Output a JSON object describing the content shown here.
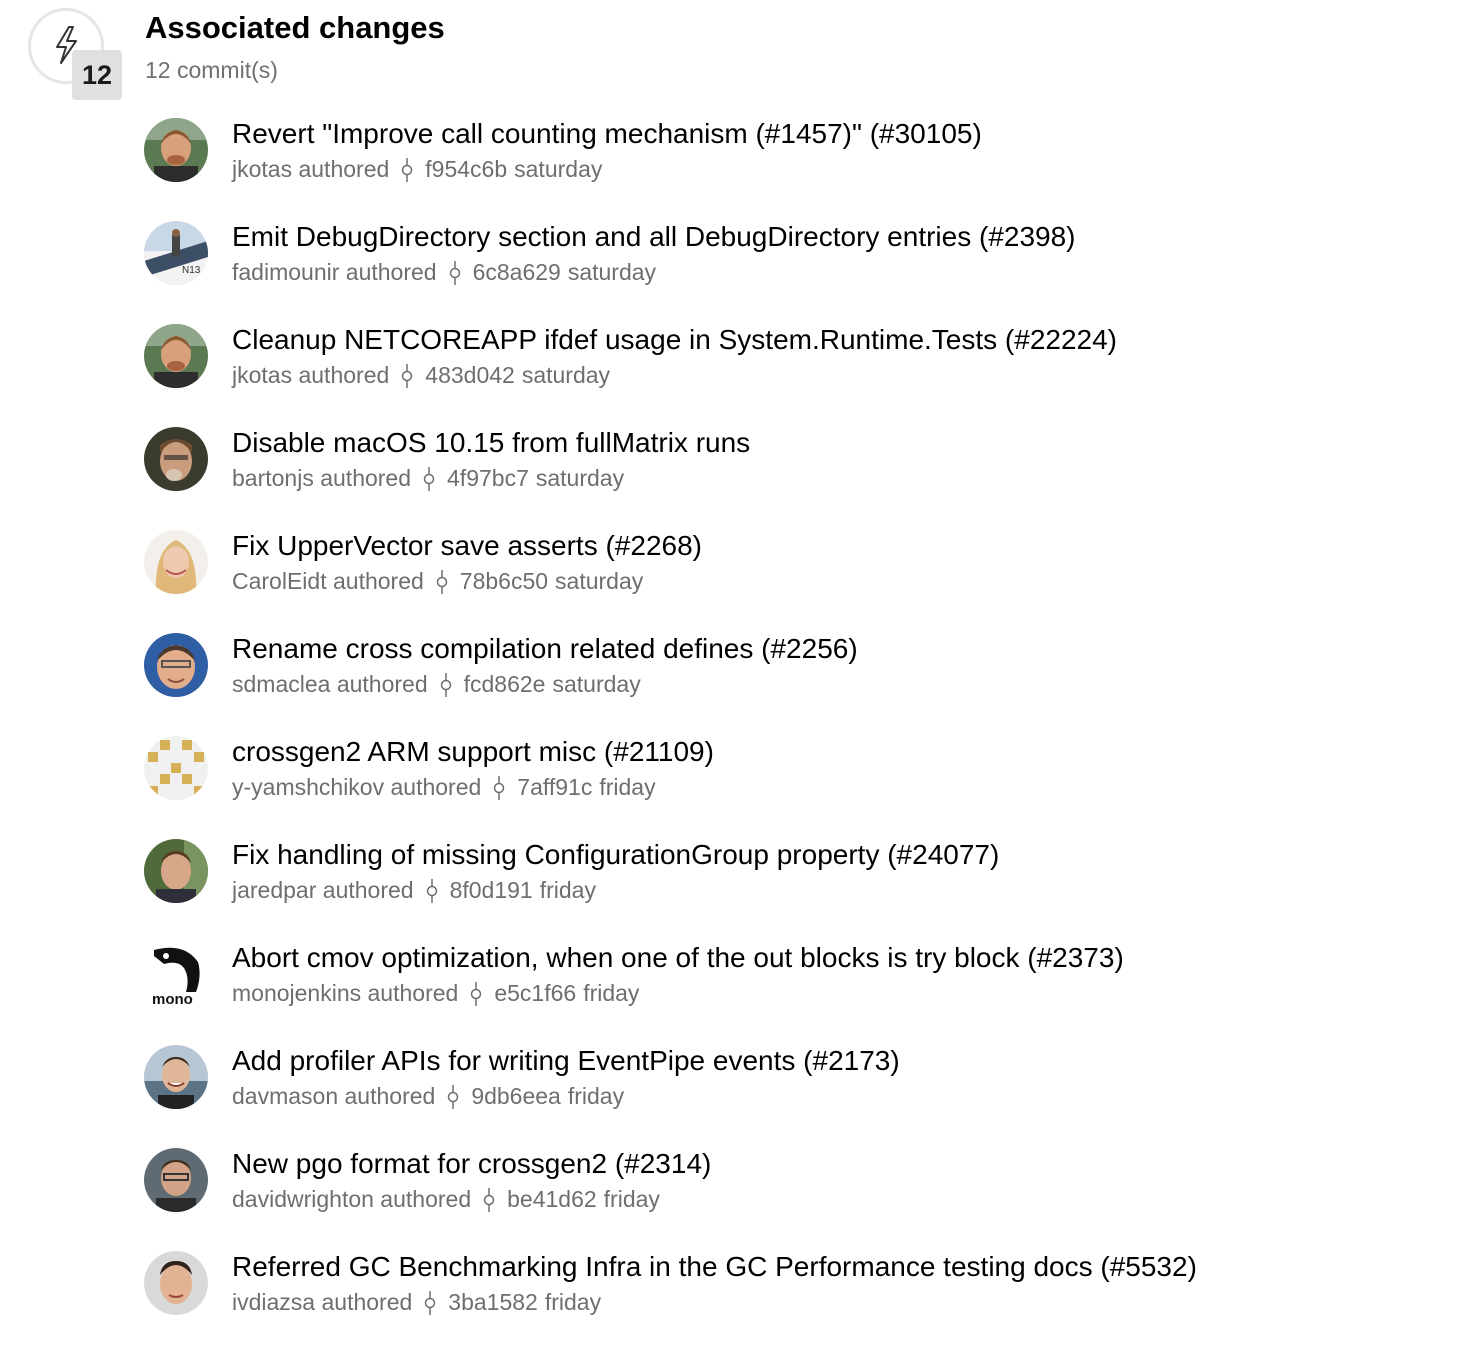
{
  "header": {
    "title": "Associated changes",
    "count": "12",
    "subtitle": "12 commit(s)",
    "icon": "lightning-icon"
  },
  "colors": {
    "title": "#000000",
    "meta": "#6e6e6e",
    "badge_bg": "#e0e0e0"
  },
  "commits": [
    {
      "title": "Revert \"Improve call counting mechanism (#1457)\" (#30105)",
      "author": "jkotas authored",
      "hash": "f954c6b",
      "when": "saturday",
      "avatar": "photo-jkotas"
    },
    {
      "title": "Emit DebugDirectory section and all DebugDirectory entries (#2398)",
      "author": "fadimounir authored",
      "hash": "6c8a629",
      "when": "saturday",
      "avatar": "photo-fadimounir"
    },
    {
      "title": "Cleanup NETCOREAPP ifdef usage in System.Runtime.Tests (#22224)",
      "author": "jkotas authored",
      "hash": "483d042",
      "when": "saturday",
      "avatar": "photo-jkotas"
    },
    {
      "title": "Disable macOS 10.15 from fullMatrix runs",
      "author": "bartonjs authored",
      "hash": "4f97bc7",
      "when": "saturday",
      "avatar": "photo-bartonjs"
    },
    {
      "title": "Fix UpperVector save asserts (#2268)",
      "author": "CarolEidt authored",
      "hash": "78b6c50",
      "when": "saturday",
      "avatar": "photo-caroleidt"
    },
    {
      "title": "Rename cross compilation related defines (#2256)",
      "author": "sdmaclea authored",
      "hash": "fcd862e",
      "when": "saturday",
      "avatar": "photo-sdmaclea"
    },
    {
      "title": "crossgen2 ARM support misc (#21109)",
      "author": "y-yamshchikov authored",
      "hash": "7aff91c",
      "when": "friday",
      "avatar": "identicon-gold"
    },
    {
      "title": "Fix handling of missing ConfigurationGroup property (#24077)",
      "author": "jaredpar authored",
      "hash": "8f0d191",
      "when": "friday",
      "avatar": "photo-jaredpar"
    },
    {
      "title": "Abort cmov optimization, when one of the out blocks is try block (#2373)",
      "author": "monojenkins authored",
      "hash": "e5c1f66",
      "when": "friday",
      "avatar": "logo-mono"
    },
    {
      "title": "Add profiler APIs for writing EventPipe events (#2173)",
      "author": "davmason authored",
      "hash": "9db6eea",
      "when": "friday",
      "avatar": "photo-davmason"
    },
    {
      "title": "New pgo format for crossgen2 (#2314)",
      "author": "davidwrighton authored",
      "hash": "be41d62",
      "when": "friday",
      "avatar": "photo-davidwrighton"
    },
    {
      "title": "Referred GC Benchmarking Infra in the GC Performance testing docs (#5532)",
      "author": "ivdiazsa authored",
      "hash": "3ba1582",
      "when": "friday",
      "avatar": "photo-ivdiazsa"
    }
  ]
}
